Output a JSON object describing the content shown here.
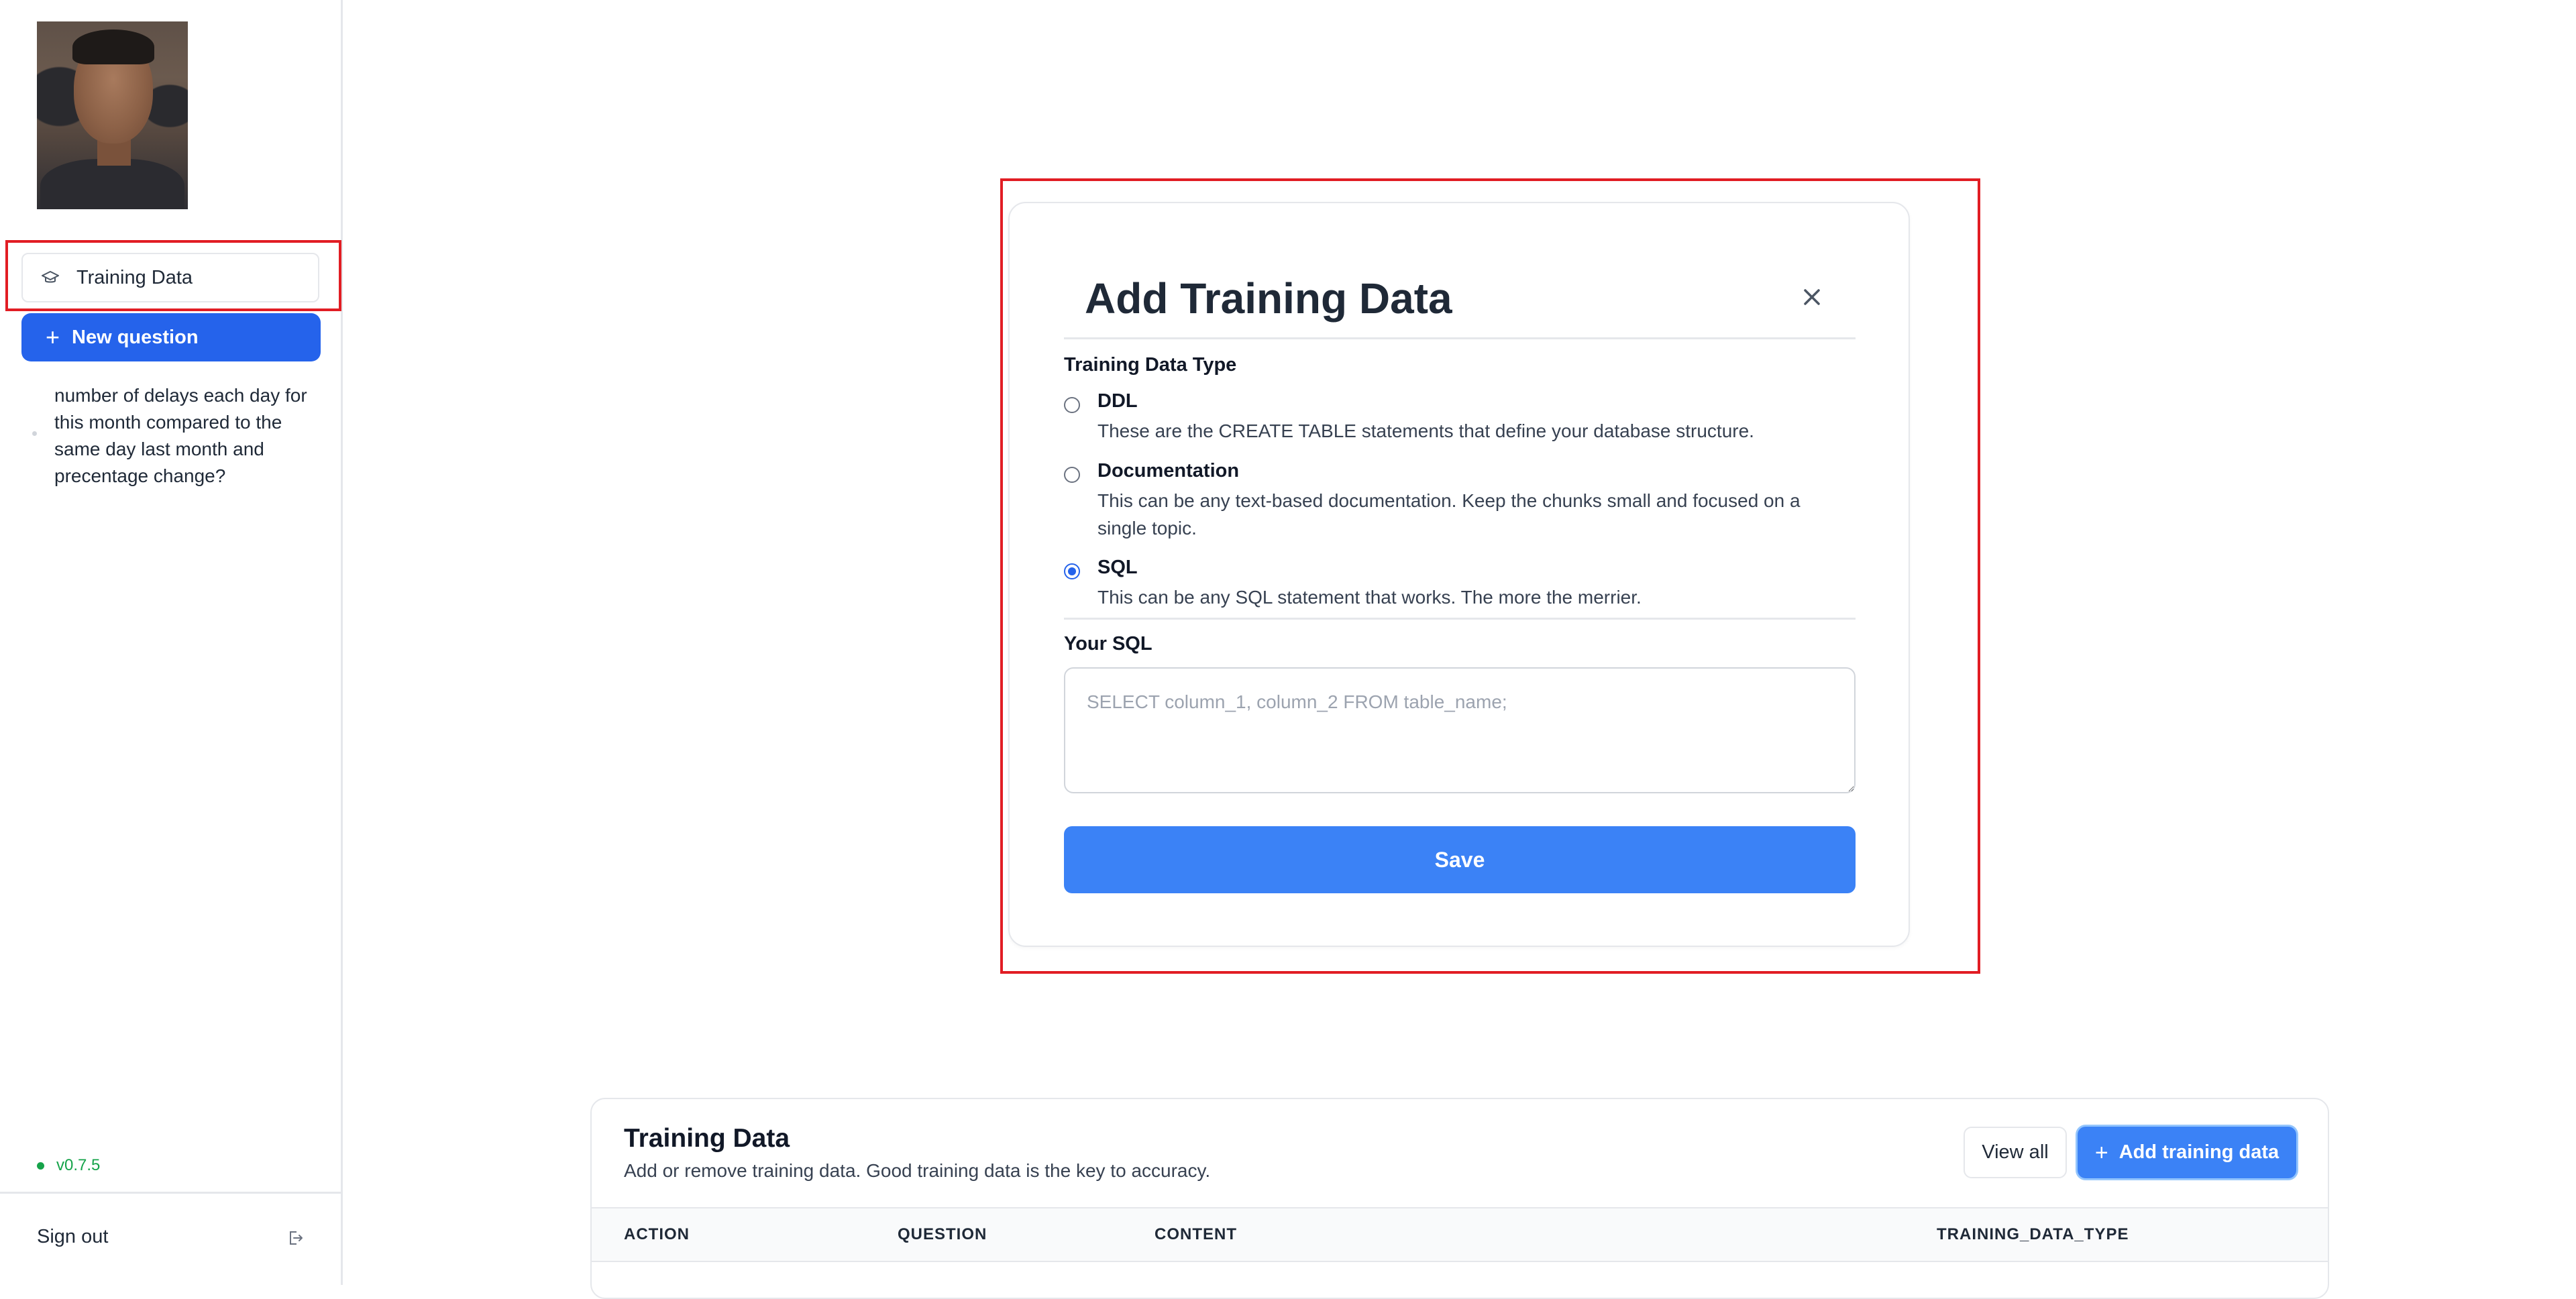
{
  "sidebar": {
    "nav_training_label": "Training Data",
    "new_question_label": "New question",
    "history": [
      "number of delays each day for this month compared to the same day last month and precentage change?"
    ],
    "version": "v0.7.5",
    "sign_out_label": "Sign out"
  },
  "modal": {
    "title": "Add Training Data",
    "type_label": "Training Data Type",
    "options": [
      {
        "title": "DDL",
        "description": "These are the CREATE TABLE statements that define your database structure.",
        "checked": false
      },
      {
        "title": "Documentation",
        "description": "This can be any text-based documentation. Keep the chunks small and focused on a single topic.",
        "checked": false
      },
      {
        "title": "SQL",
        "description": "This can be any SQL statement that works. The more the merrier.",
        "checked": true
      }
    ],
    "input_label": "Your SQL",
    "input_placeholder": "SELECT column_1, column_2 FROM table_name;",
    "save_label": "Save"
  },
  "panel": {
    "title": "Training Data",
    "subtitle": "Add or remove training data. Good training data is the key to accuracy.",
    "view_all_label": "View all",
    "add_label": "Add training data",
    "columns": [
      "ACTION",
      "QUESTION",
      "CONTENT",
      "TRAINING_DATA_TYPE"
    ]
  },
  "colors": {
    "primary": "#3b82f6",
    "primary_dark": "#2563eb",
    "highlight": "#e11d24",
    "status_green": "#16a34a"
  },
  "icons": {
    "nav_training": "graduation-cap-icon",
    "close": "close-icon",
    "sign_out": "sign-out-icon",
    "plus": "plus-icon"
  }
}
